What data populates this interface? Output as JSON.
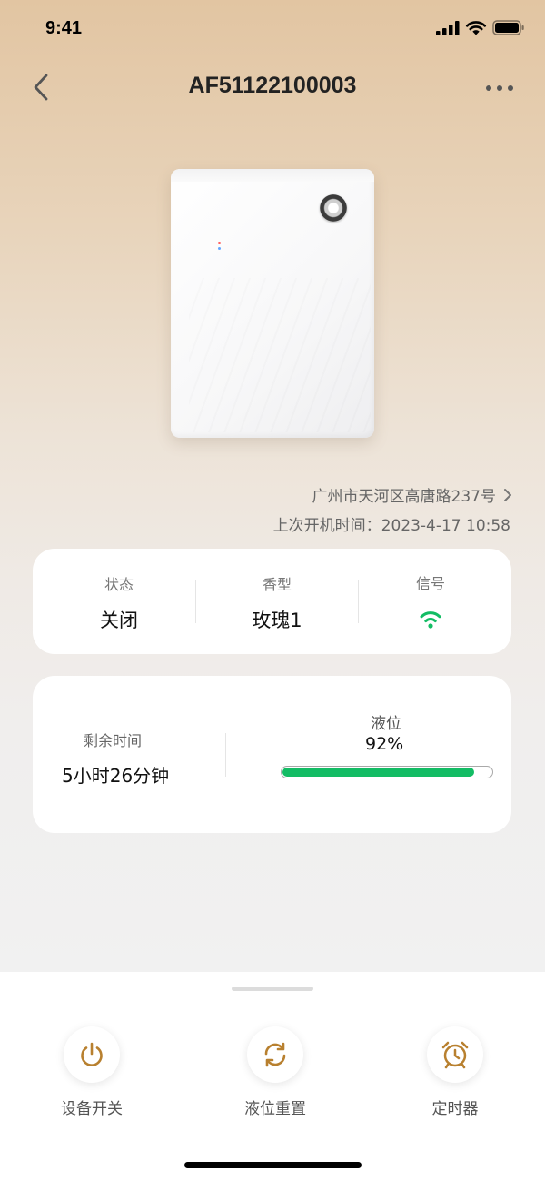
{
  "status_bar": {
    "time": "9:41",
    "icons": [
      "cellular-signal-icon",
      "wifi-icon",
      "battery-icon"
    ]
  },
  "nav": {
    "title": "AF51122100003",
    "back_icon": "chevron-left-icon",
    "more_icon": "more-dots-icon"
  },
  "device": {
    "image": "aroma-diffuser-device"
  },
  "info": {
    "address": "广州市天河区高唐路237号",
    "last_on": "上次开机时间：2023-4-17 10:58"
  },
  "status_card": {
    "state_label": "状态",
    "state_value": "关闭",
    "scent_label": "香型",
    "scent_value": "玫瑰1",
    "signal_label": "信号",
    "signal_icon": "wifi-signal-icon",
    "signal_color": "#13bc64"
  },
  "liquid_card": {
    "remaining_label": "剩余时间",
    "remaining_value": "5小时26分钟",
    "level_label": "液位",
    "level_value": "92%",
    "level_fraction": 0.92,
    "level_color": "#13bc64"
  },
  "actions": [
    {
      "label": "设备开关",
      "icon": "power-icon"
    },
    {
      "label": "液位重置",
      "icon": "refresh-icon"
    },
    {
      "label": "定时器",
      "icon": "alarm-clock-icon"
    }
  ],
  "accent_color": "#b8802f"
}
